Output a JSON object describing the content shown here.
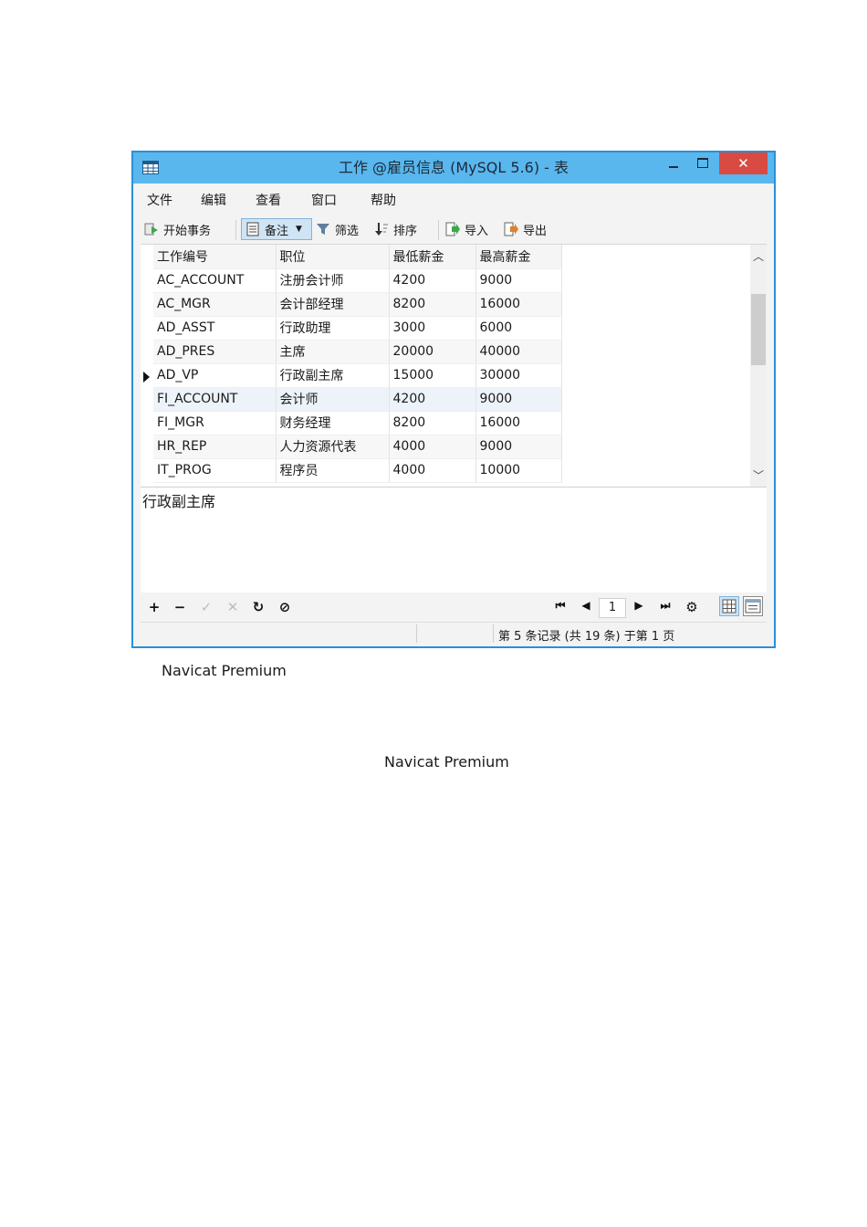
{
  "window": {
    "title": "工作 @雇员信息 (MySQL 5.6) - 表",
    "close_label": "✕"
  },
  "menu": [
    "文件",
    "编辑",
    "查看",
    "窗口",
    "帮助"
  ],
  "toolbar": {
    "begin_transaction": "开始事务",
    "memo": "备注",
    "filter": "筛选",
    "sort": "排序",
    "import": "导入",
    "export": "导出"
  },
  "grid": {
    "columns": [
      "工作编号",
      "职位",
      "最低薪金",
      "最高薪金"
    ],
    "rows": [
      [
        "AC_ACCOUNT",
        "注册会计师",
        "4200",
        "9000"
      ],
      [
        "AC_MGR",
        "会计部经理",
        "8200",
        "16000"
      ],
      [
        "AD_ASST",
        "行政助理",
        "3000",
        "6000"
      ],
      [
        "AD_PRES",
        "主席",
        "20000",
        "40000"
      ],
      [
        "AD_VP",
        "行政副主席",
        "15000",
        "30000"
      ],
      [
        "FI_ACCOUNT",
        "会计师",
        "4200",
        "9000"
      ],
      [
        "FI_MGR",
        "财务经理",
        "8200",
        "16000"
      ],
      [
        "HR_REP",
        "人力资源代表",
        "4000",
        "9000"
      ],
      [
        "IT_PROG",
        "程序员",
        "4000",
        "10000"
      ]
    ],
    "current_row": 5
  },
  "memo_text": "行政副主席",
  "nav": {
    "page": "1",
    "add": "+",
    "delete": "−",
    "apply": "✓",
    "cancel": "✕",
    "refresh": "↻",
    "stop": "⊘",
    "first": "⏮",
    "prev": "◀",
    "next": "▶",
    "last": "⏭",
    "settings": "⚙"
  },
  "status": "第 5 条记录 (共 19 条) 于第 1 页",
  "captions": [
    "Navicat Premium",
    "Navicat Premium"
  ]
}
